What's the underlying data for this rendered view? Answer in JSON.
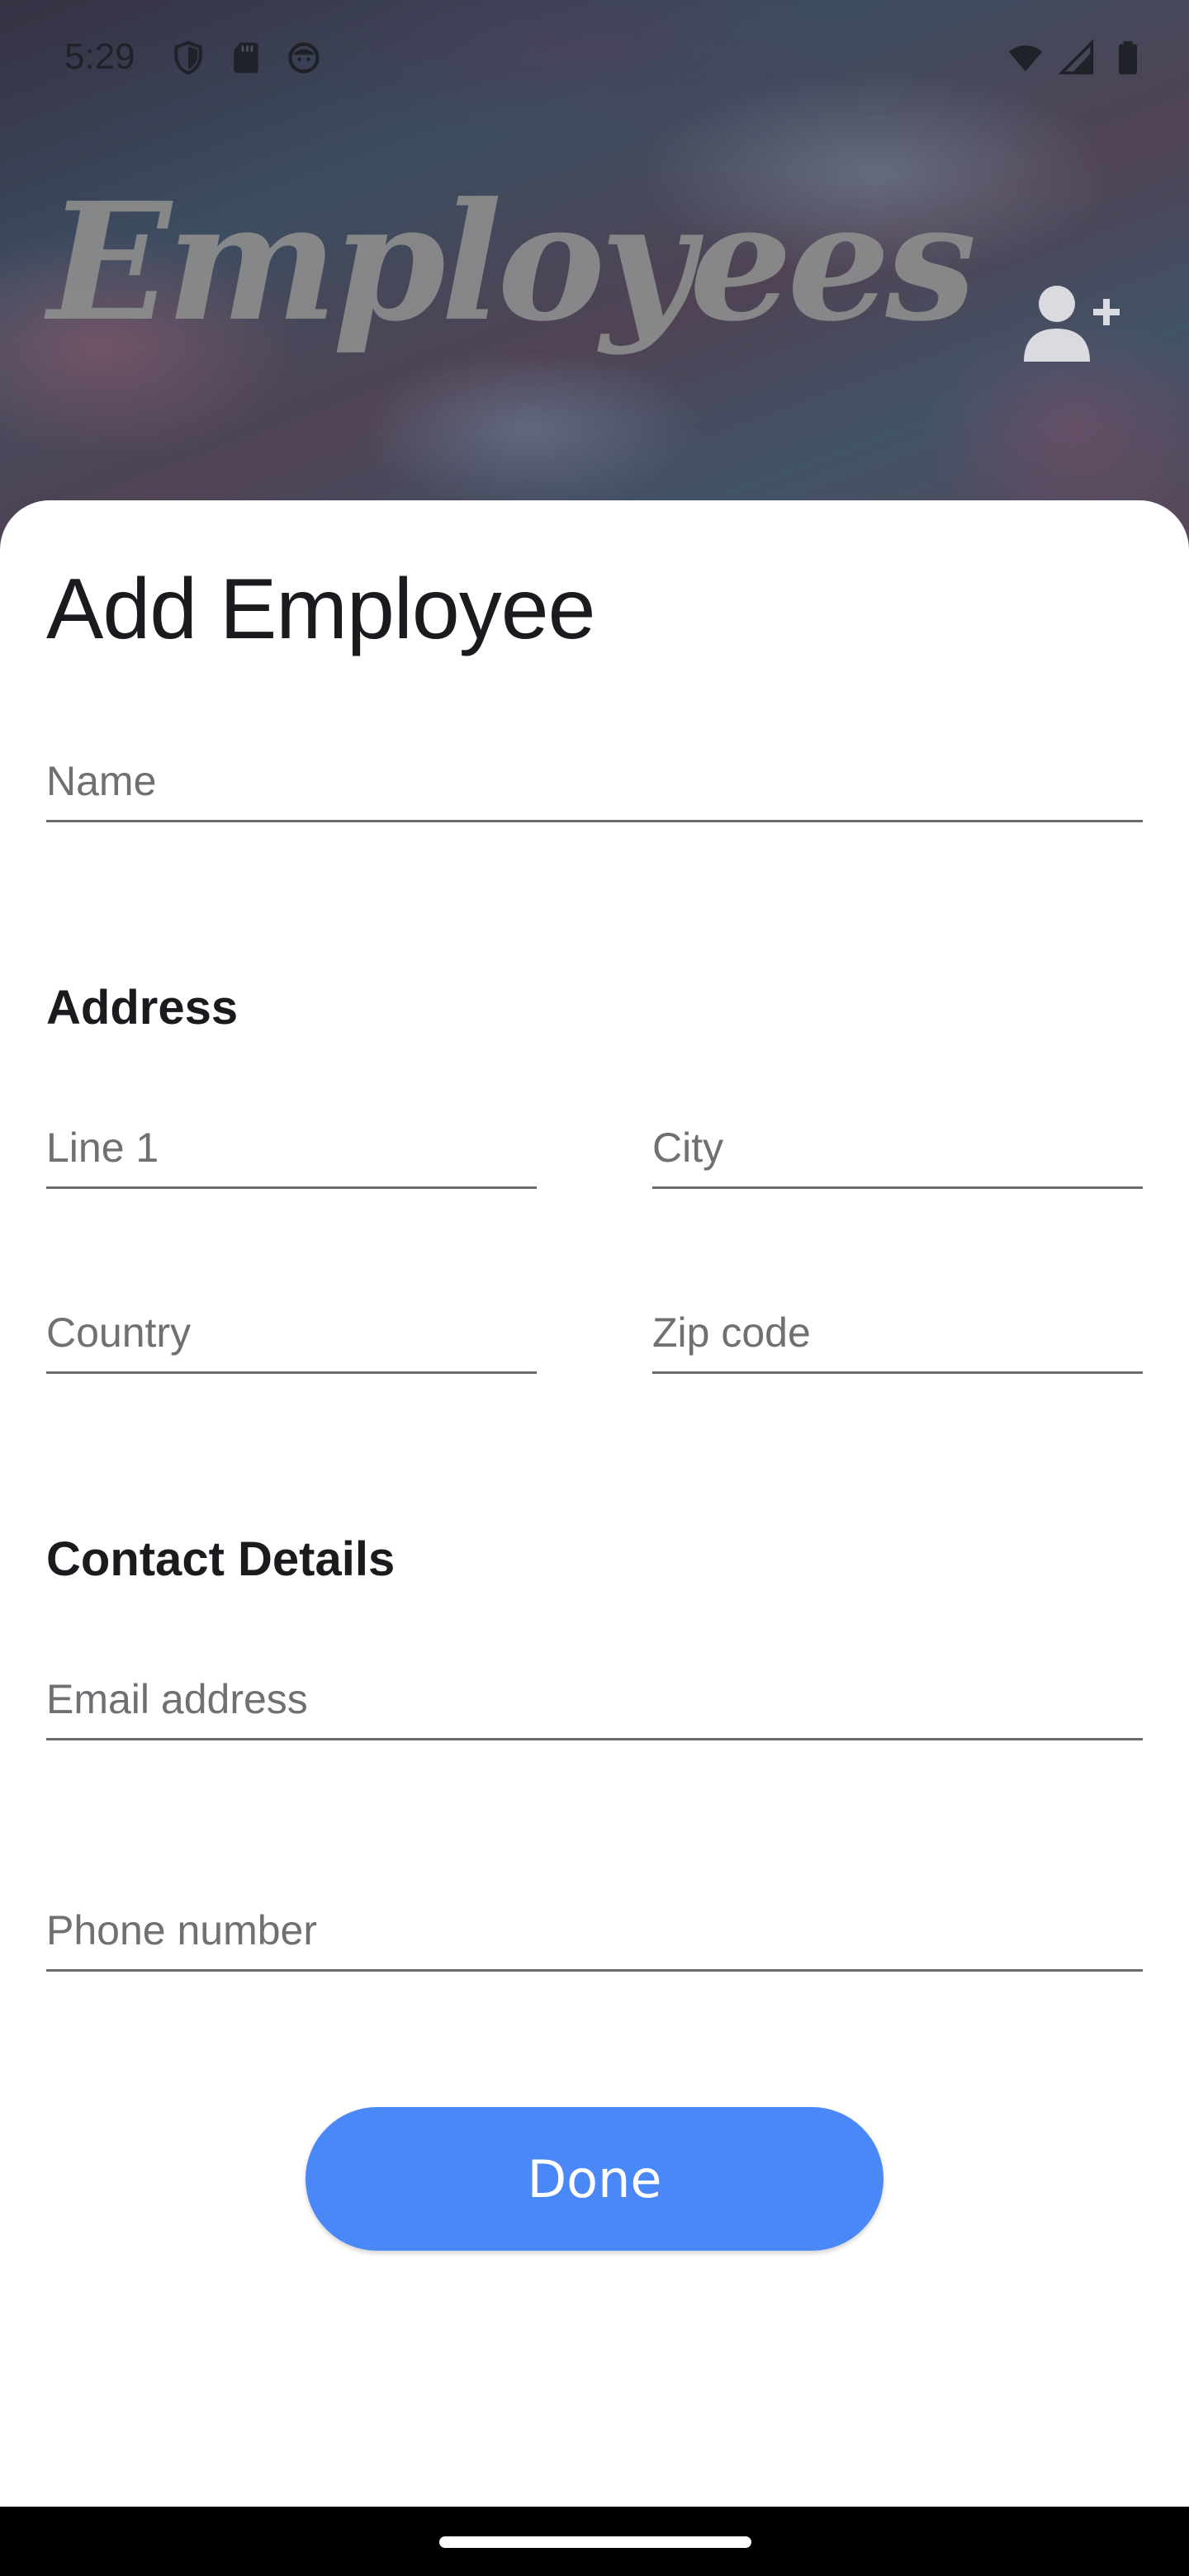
{
  "status_bar": {
    "time": "5:29",
    "left_icons": [
      "shield-icon",
      "sd-card-icon",
      "face-icon"
    ],
    "right_icons": [
      "wifi-icon",
      "cellular-signal-icon",
      "battery-icon"
    ]
  },
  "header": {
    "title": "Employees",
    "action_icon": "add-person-icon"
  },
  "form": {
    "title": "Add Employee",
    "name_placeholder": "Name",
    "address_heading": "Address",
    "line1_placeholder": "Line 1",
    "city_placeholder": "City",
    "country_placeholder": "Country",
    "zip_placeholder": "Zip code",
    "contact_heading": "Contact Details",
    "email_placeholder": "Email address",
    "phone_placeholder": "Phone number",
    "done_label": "Done"
  },
  "colors": {
    "accent": "#4a87f7",
    "sheet_background": "#ffffff",
    "field_underline": "#6b6b6f"
  }
}
